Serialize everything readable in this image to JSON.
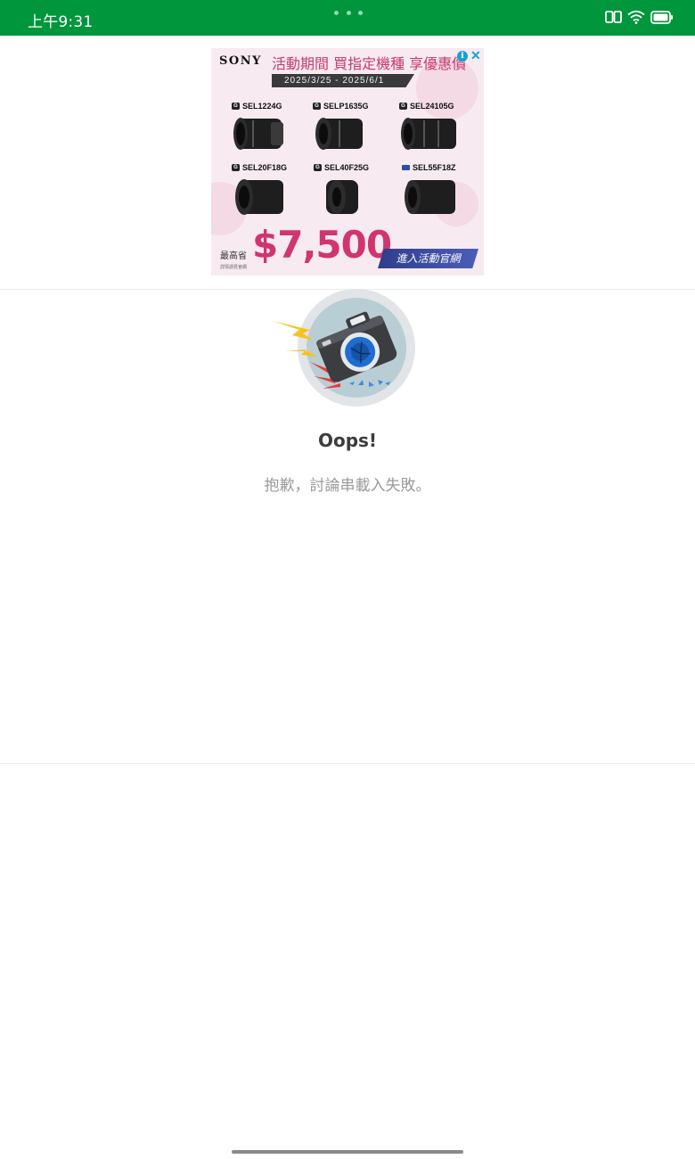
{
  "status_bar": {
    "time": "上午9:31",
    "background": "#00963c",
    "icons": [
      "reader-icon",
      "wifi-icon",
      "battery-icon"
    ]
  },
  "ad": {
    "brand": "SONY",
    "headline": "活動期間 買指定機種 享優惠價",
    "dates": "2025/3/25 - 2025/6/1",
    "info_icon": "i",
    "close_icon": "✕",
    "products": [
      {
        "label": "SEL1224G",
        "mark": "G"
      },
      {
        "label": "SELP1635G",
        "mark": "G"
      },
      {
        "label": "SEL24105G",
        "mark": "G"
      },
      {
        "label": "SEL20F18G",
        "mark": "G"
      },
      {
        "label": "SEL40F25G",
        "mark": "G"
      },
      {
        "label": "SEL55F18Z",
        "mark": "Z"
      }
    ],
    "save_label": "最高省",
    "price": "$7,500",
    "fine_print": "詳情請見官網",
    "cta": "進入活動官網",
    "accent_color": "#d0356f"
  },
  "error": {
    "title": "Oops!",
    "message": "抱歉，討論串載入失敗。"
  }
}
